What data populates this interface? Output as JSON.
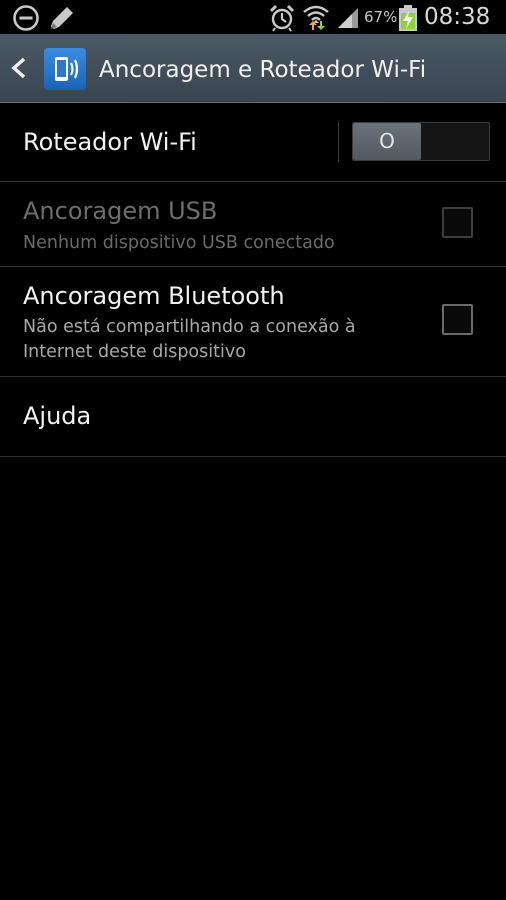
{
  "status_bar": {
    "left_icons": [
      "do-not-disturb-icon",
      "pencil-icon"
    ],
    "right_icons": [
      "alarm-clock-icon",
      "wifi-icon",
      "signal-icon",
      "battery-charging-icon"
    ],
    "battery_percent": "67%",
    "time": "08:38"
  },
  "action_bar": {
    "back_icon": "chevron-left-icon",
    "app_icon": "tethering-icon",
    "title": "Ancoragem e Roteador Wi-Fi"
  },
  "settings": {
    "wifi_hotspot": {
      "title": "Roteador Wi-Fi",
      "toggle_label": "O",
      "state": "off"
    },
    "usb_tethering": {
      "title": "Ancoragem USB",
      "summary": "Nenhum dispositivo USB conectado",
      "enabled": false,
      "checked": false
    },
    "bluetooth_tethering": {
      "title": "Ancoragem Bluetooth",
      "summary": "Não está compartilhando a conexão à Internet deste dispositivo",
      "enabled": true,
      "checked": false
    },
    "help": {
      "title": "Ajuda"
    }
  },
  "colors": {
    "background": "#000000",
    "action_bar": "#424f5a",
    "accent_blue": "#2a78d0",
    "battery_green": "#8bd13a"
  }
}
